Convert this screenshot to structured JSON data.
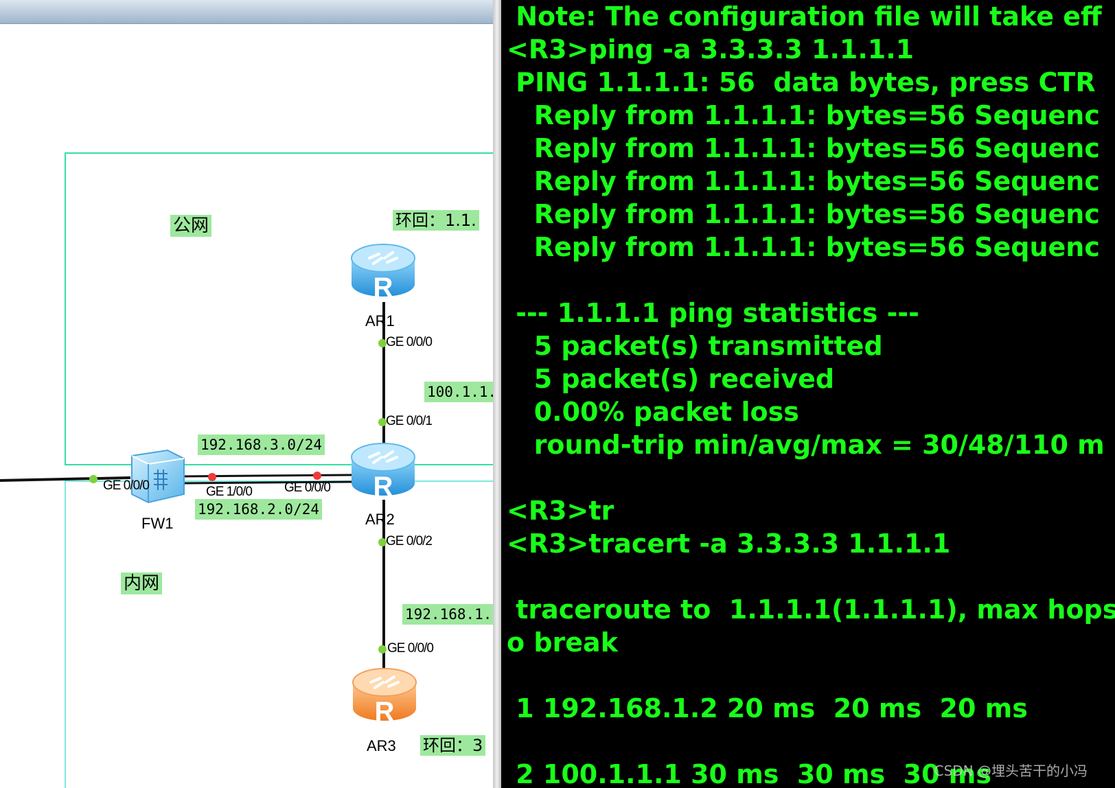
{
  "topology": {
    "zones": {
      "public_label": "公网",
      "private_label": "内网"
    },
    "tags": {
      "loopback_ar1": "环回：1.1.",
      "link_ar1_ar2": "100.1.1.",
      "fw_ar2_upper": "192.168.3.0/24",
      "fw_ar2_lower": "192.168.2.0/24",
      "link_ar2_ar3": "192.168.1.",
      "loopback_ar3": "环回：3"
    },
    "devices": {
      "ar1": "AR1",
      "ar2": "AR2",
      "ar3": "AR3",
      "fw1": "FW1"
    },
    "interfaces": {
      "ar1_ge000": "GE 0/0/0",
      "ar2_ge001": "GE 0/0/1",
      "ar2_ge000": "GE 0/0/0",
      "ar2_ge002": "GE 0/0/2",
      "ar3_ge000": "GE 0/0/0",
      "fw1_ge000": "GE 0/0/0",
      "fw1_ge100": "GE 1/0/0"
    },
    "colors": {
      "router_blue": "#3aa6e8",
      "router_orange": "#f08a30",
      "link_dot_green": "#7fd13b",
      "link_dot_red": "#ef3b3b"
    }
  },
  "terminal": {
    "lines": [
      " Note: The configuration file will take eff",
      "<R3>ping -a 3.3.3.3 1.1.1.1",
      " PING 1.1.1.1: 56  data bytes, press CTR",
      "   Reply from 1.1.1.1: bytes=56 Sequenc",
      "   Reply from 1.1.1.1: bytes=56 Sequenc",
      "   Reply from 1.1.1.1: bytes=56 Sequenc",
      "   Reply from 1.1.1.1: bytes=56 Sequenc",
      "   Reply from 1.1.1.1: bytes=56 Sequenc",
      "",
      " --- 1.1.1.1 ping statistics ---",
      "   5 packet(s) transmitted",
      "   5 packet(s) received",
      "   0.00% packet loss",
      "   round-trip min/avg/max = 30/48/110 m",
      "",
      "<R3>tr",
      "<R3>tracert -a 3.3.3.3 1.1.1.1",
      "",
      " traceroute to  1.1.1.1(1.1.1.1), max hops",
      "o break",
      "",
      " 1 192.168.1.2 20 ms  20 ms  20 ms",
      "",
      " 2 100.1.1.1 30 ms  30 ms  30 ms"
    ],
    "text_color": "#19ff19"
  },
  "watermark": "CSDN @埋头苦干的小冯"
}
